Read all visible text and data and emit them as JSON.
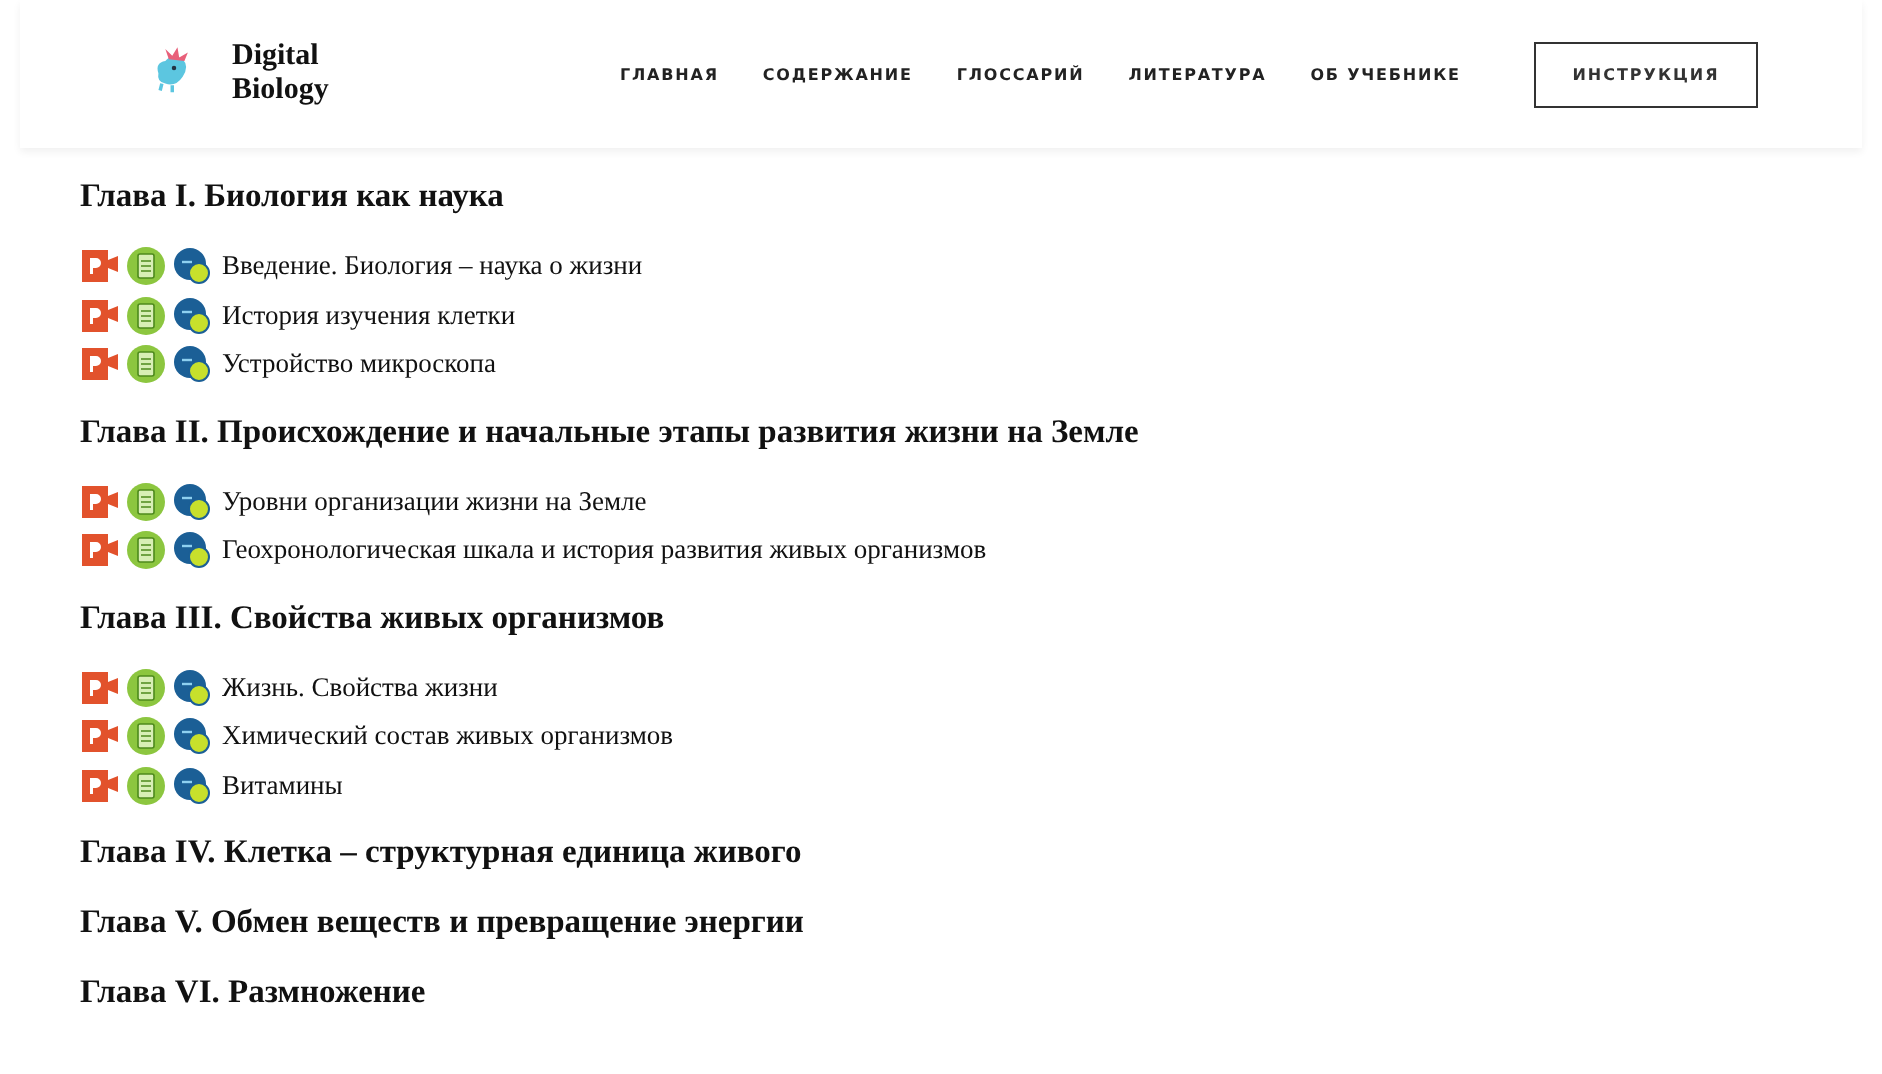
{
  "header": {
    "logo_text": [
      "Digital",
      "Biology"
    ],
    "nav": [
      "ГЛАВНАЯ",
      "СОДЕРЖАНИЕ",
      "ГЛОССАРИЙ",
      "ЛИТЕРАТУРА",
      "ОБ УЧЕБНИКЕ"
    ],
    "button": "ИНСТРУКЦИЯ"
  },
  "chapters": [
    {
      "title": "Глава I. Биология как наука",
      "lessons": [
        "Введение. Биология – наука о жизни",
        "История изучения клетки",
        "Устройство микроскопа"
      ]
    },
    {
      "title": "Глава II. Происхождение и начальные этапы развития жизни на Земле",
      "lessons": [
        "Уровни организации жизни на Земле",
        "Геохронологическая шкала и история развития живых организмов"
      ]
    },
    {
      "title": "Глава III. Свойства живых организмов",
      "lessons": [
        "Жизнь. Свойства жизни",
        "Химический состав живых организмов",
        "Витамины"
      ]
    },
    {
      "title": "Глава IV. Клетка – структурная единица живого"
    },
    {
      "title": "Глава V. Обмен веществ и превращение энергии"
    },
    {
      "title": "Глава VI. Размножение"
    }
  ]
}
